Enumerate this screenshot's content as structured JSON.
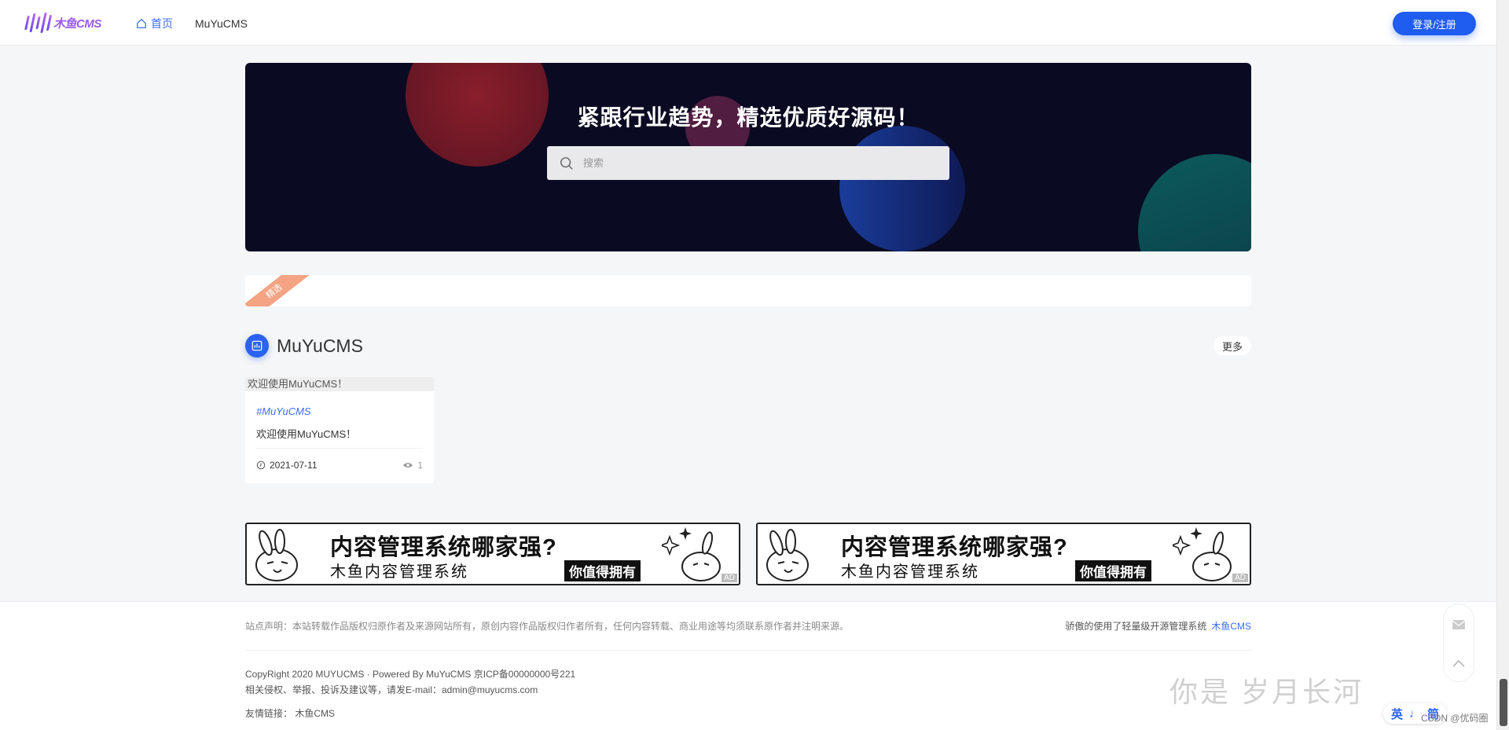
{
  "header": {
    "logo_text": "木鱼CMS",
    "nav": [
      {
        "label": "首页",
        "active": true
      },
      {
        "label": "MuYuCMS",
        "active": false
      }
    ],
    "login_label": "登录/注册"
  },
  "banner": {
    "title": "紧跟行业趋势，精选优质好源码！",
    "search_placeholder": "搜索"
  },
  "featured": {
    "ribbon": "精选"
  },
  "section": {
    "title": "MuYuCMS",
    "more_label": "更多"
  },
  "articles": [
    {
      "image_alt": "欢迎使用MuYuCMS！",
      "tag": "#MuYuCMS",
      "title": "欢迎使用MuYuCMS！",
      "date": "2021-07-11",
      "views": "1"
    }
  ],
  "ads": [
    {
      "headline": "内容管理系统哪家强?",
      "sub": "木鱼内容管理系统",
      "slogan": "你值得拥有",
      "badge": "AD"
    },
    {
      "headline": "内容管理系统哪家强?",
      "sub": "木鱼内容管理系统",
      "slogan": "你值得拥有",
      "badge": "AD"
    }
  ],
  "footer": {
    "notice": "站点声明：本站转载作品版权归原作者及来源网站所有，原创内容作品版权归作者所有，任何内容转载、商业用途等均须联系原作者并注明来源。",
    "powered_text": "骄傲的使用了轻量级开源管理系统",
    "powered_link": "木鱼CMS",
    "copyright": "CopyRight 2020 MUYUCMS · Powered By MuYuCMS   京ICP备00000000号221",
    "report": "相关侵权、举报、投诉及建议等，请发E-mail：admin@muyucms.com",
    "friend_links_label": "友情链接：",
    "friend_links": [
      "木鱼CMS"
    ]
  },
  "overlay": {
    "watermark": "你是 岁月长河",
    "ime": [
      "英",
      "♩",
      "简"
    ],
    "csdn": "CSDN @优码圈"
  },
  "colors": {
    "primary": "#1f5cf0",
    "banner_bg": "#0a0a22",
    "ribbon": "#f4a383",
    "page_bg": "#f5f6f7"
  }
}
